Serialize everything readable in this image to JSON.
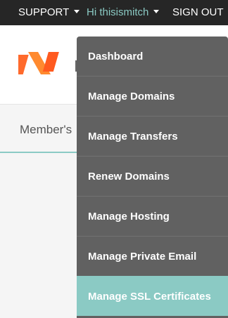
{
  "topbar": {
    "support_label": "SUPPORT",
    "greeting": "Hi thisismitch",
    "signout_label": "SIGN OUT"
  },
  "subnav": {
    "member_label": "Member's"
  },
  "colors": {
    "accent": "#8bcac4",
    "topbar_bg": "#262626",
    "menu_bg": "#616161",
    "logo_orange": "#ff5a1f"
  },
  "dropdown": {
    "items": [
      {
        "label": "Dashboard"
      },
      {
        "label": "Manage Domains"
      },
      {
        "label": "Manage Transfers"
      },
      {
        "label": "Renew Domains"
      },
      {
        "label": "Manage Hosting"
      },
      {
        "label": "Manage Private Email"
      },
      {
        "label": "Manage SSL Certificates",
        "active": true
      }
    ]
  }
}
